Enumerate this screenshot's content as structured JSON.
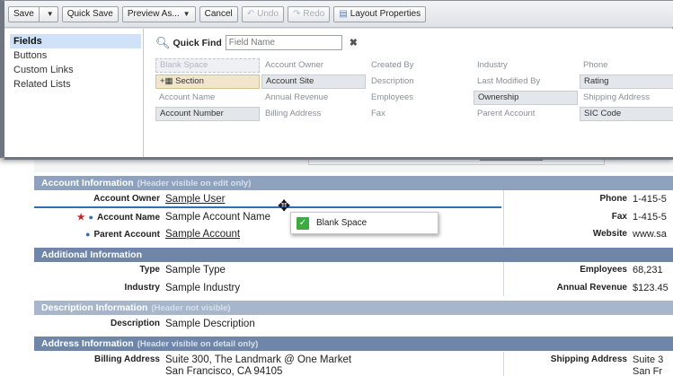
{
  "toolbar": {
    "save": "Save",
    "quick_save": "Quick Save",
    "preview_as": "Preview As...",
    "cancel": "Cancel",
    "undo": "Undo",
    "redo": "Redo",
    "layout_properties": "Layout Properties"
  },
  "categories": [
    "Fields",
    "Buttons",
    "Custom Links",
    "Related Lists"
  ],
  "quick_find": {
    "label": "Quick Find",
    "placeholder": "Field Name"
  },
  "palette_fields": [
    [
      "Blank Space",
      "Account Owner",
      "Created By",
      "Industry",
      "Phone"
    ],
    [
      "Section",
      "Account Site",
      "Description",
      "Last Modified By",
      "Rating"
    ],
    [
      "Account Name",
      "Annual Revenue",
      "Employees",
      "Ownership",
      "Shipping Address"
    ],
    [
      "Account Number",
      "Billing Address",
      "Fax",
      "Parent Account",
      "SIC Code"
    ]
  ],
  "sections": {
    "account_info": {
      "title": "Account Information",
      "note": "(Header visible on edit only)"
    },
    "additional_info": {
      "title": "Additional Information"
    },
    "description_info": {
      "title": "Description Information",
      "note": "(Header not visible)"
    },
    "address_info": {
      "title": "Address Information",
      "note": "(Header visible on detail only)"
    }
  },
  "fields": {
    "account_owner": {
      "label": "Account Owner",
      "value": "Sample User"
    },
    "account_name": {
      "label": "Account Name",
      "value": "Sample Account Name"
    },
    "parent_account": {
      "label": "Parent Account",
      "value": "Sample Account"
    },
    "phone": {
      "label": "Phone",
      "value": "1-415-5"
    },
    "fax": {
      "label": "Fax",
      "value": "1-415-5"
    },
    "website": {
      "label": "Website",
      "value": "www.sa"
    },
    "type": {
      "label": "Type",
      "value": "Sample Type"
    },
    "industry": {
      "label": "Industry",
      "value": "Sample Industry"
    },
    "employees": {
      "label": "Employees",
      "value": "68,231"
    },
    "annual_revenue": {
      "label": "Annual Revenue",
      "value": "$123.45"
    },
    "description": {
      "label": "Description",
      "value": "Sample Description"
    },
    "billing_address": {
      "label": "Billing Address",
      "value_line1": "Suite 300, The Landmark @ One Market",
      "value_line2": "San Francisco, CA 94105"
    },
    "shipping_address": {
      "label": "Shipping Address",
      "value_line1": "Suite 3",
      "value_line2": "San Fr"
    }
  },
  "drag_item": {
    "label": "Blank Space"
  },
  "colors": {
    "section_header": "#8ea2bd",
    "drop_indicator": "#2f6fb6",
    "required_star": "#c0272d",
    "selected_category": "#cfe2f7"
  }
}
